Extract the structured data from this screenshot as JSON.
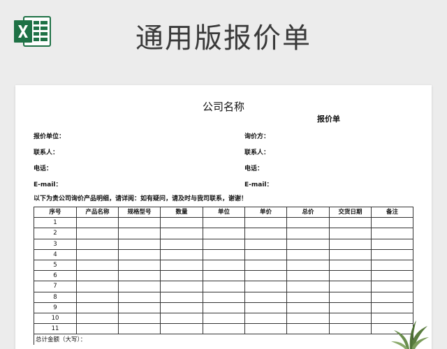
{
  "banner": {
    "title": "通用版报价单"
  },
  "document": {
    "company_name": "公司名称",
    "quote_label": "报价单",
    "left_fields": [
      "报价单位：",
      "联系人：",
      "电话：",
      "E-mail："
    ],
    "right_fields": [
      "询价方：",
      "联系人：",
      "电话：",
      "E-mail："
    ],
    "note": "以下为贵公司询价产品明细，请详阅：如有疑问，请及时与我司联系，谢谢！",
    "table": {
      "headers": [
        "序号",
        "产品名称",
        "规格型号",
        "数量",
        "单位",
        "单价",
        "总价",
        "交货日期",
        "备注"
      ],
      "row_numbers": [
        "1",
        "2",
        "3",
        "4",
        "5",
        "6",
        "7",
        "8",
        "9",
        "10",
        "11"
      ],
      "total_label": "总计金额（大写）："
    }
  },
  "colors": {
    "excel_green": "#1e7145",
    "excel_light": "#21a366",
    "background": "#ececec"
  },
  "icons": {
    "logo": "excel-logo-icon",
    "decoration": "plant-icon"
  }
}
